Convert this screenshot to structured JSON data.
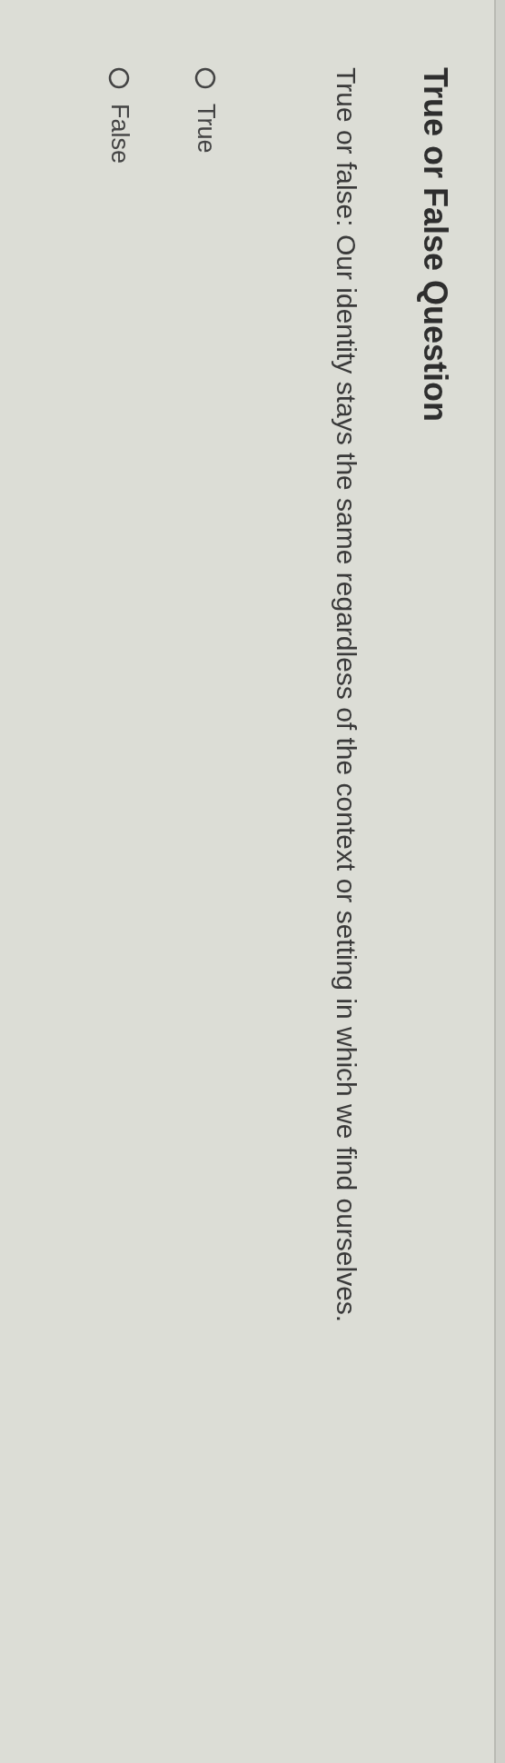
{
  "title": "True or False Question",
  "question": "True or false: Our identity stays the same regardless of the context or setting in which we find ourselves.",
  "options": [
    {
      "label": "True",
      "selected": false
    },
    {
      "label": "False",
      "selected": false
    }
  ]
}
